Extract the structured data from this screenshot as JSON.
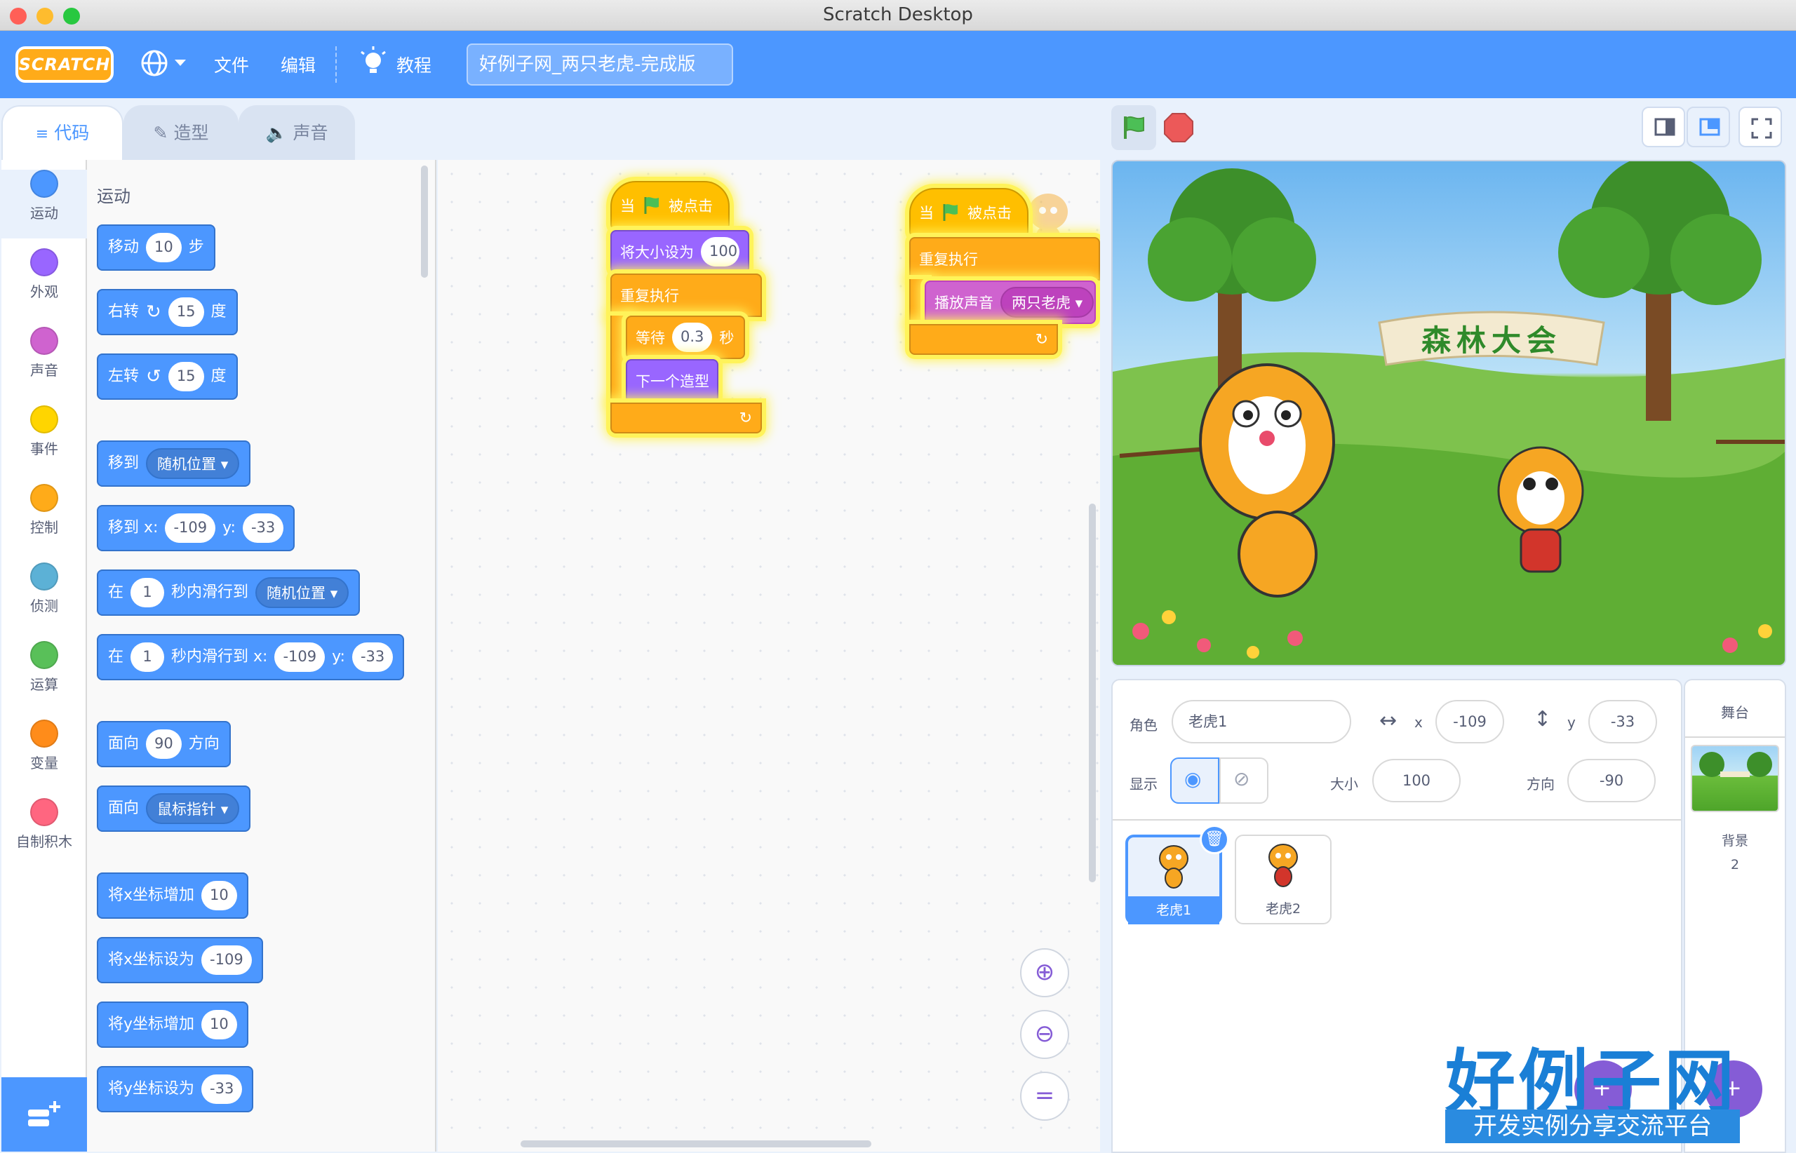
{
  "window": {
    "title": "Scratch Desktop"
  },
  "menubar": {
    "logo": "SCRATCH",
    "file": "文件",
    "edit": "编辑",
    "tutorials": "教程",
    "project_title": "好例子网_两只老虎-完成版"
  },
  "tabs": [
    {
      "label": "代码",
      "icon": "code-icon"
    },
    {
      "label": "造型",
      "icon": "brush-icon"
    },
    {
      "label": "声音",
      "icon": "speaker-icon"
    }
  ],
  "categories": [
    {
      "label": "运动",
      "color": "#4c97ff"
    },
    {
      "label": "外观",
      "color": "#9966ff"
    },
    {
      "label": "声音",
      "color": "#cf63cf"
    },
    {
      "label": "事件",
      "color": "#ffd500"
    },
    {
      "label": "控制",
      "color": "#ffab19"
    },
    {
      "label": "侦测",
      "color": "#5cb1d6"
    },
    {
      "label": "运算",
      "color": "#59c059"
    },
    {
      "label": "变量",
      "color": "#ff8c1a"
    },
    {
      "label": "自制积木",
      "color": "#ff6680"
    }
  ],
  "palette": {
    "heading": "运动",
    "move": {
      "a": "移动",
      "v": "10",
      "b": "步"
    },
    "turn_right": {
      "a": "右转",
      "v": "15",
      "b": "度"
    },
    "turn_left": {
      "a": "左转",
      "v": "15",
      "b": "度"
    },
    "goto": {
      "a": "移到",
      "dd": "随机位置"
    },
    "goto_xy": {
      "a": "移到 x:",
      "x": "-109",
      "yl": "y:",
      "y": "-33"
    },
    "glide": {
      "a": "在",
      "v": "1",
      "b": "秒内滑行到",
      "dd": "随机位置"
    },
    "glide_xy": {
      "a": "在",
      "v": "1",
      "b": "秒内滑行到 x:",
      "x": "-109",
      "yl": "y:",
      "y": "-33"
    },
    "point_dir": {
      "a": "面向",
      "v": "90",
      "b": "方向"
    },
    "point_towards": {
      "a": "面向",
      "dd": "鼠标指针"
    },
    "change_x": {
      "a": "将x坐标增加",
      "v": "10"
    },
    "set_x": {
      "a": "将x坐标设为",
      "v": "-109"
    },
    "change_y": {
      "a": "将y坐标增加",
      "v": "10"
    },
    "set_y": {
      "a": "将y坐标设为",
      "v": "-33"
    }
  },
  "scripts": {
    "s1": {
      "hat_a": "当",
      "hat_b": "被点击",
      "setsize": "将大小设为",
      "setsize_v": "100",
      "forever": "重复执行",
      "wait": "等待",
      "wait_v": "0.3",
      "wait_u": "秒",
      "next": "下一个造型"
    },
    "s2": {
      "hat_a": "当",
      "hat_b": "被点击",
      "forever": "重复执行",
      "play": "播放声音",
      "play_dd": "两只老虎"
    }
  },
  "stage": {
    "banner": "森林大会"
  },
  "sprite_info": {
    "sprite_label": "角色",
    "sprite_name": "老虎1",
    "x_label": "x",
    "x": "-109",
    "y_label": "y",
    "y": "-33",
    "show_label": "显示",
    "size_label": "大小",
    "size": "100",
    "direction_label": "方向",
    "direction": "-90"
  },
  "sprites": [
    {
      "name": "老虎1",
      "selected": true
    },
    {
      "name": "老虎2",
      "selected": false
    }
  ],
  "stage_panel": {
    "title": "舞台",
    "backdrops_label": "背景",
    "backdrops_count": "2"
  },
  "watermark": {
    "main": "好例子网",
    "sub": "开发实例分享交流平台"
  }
}
